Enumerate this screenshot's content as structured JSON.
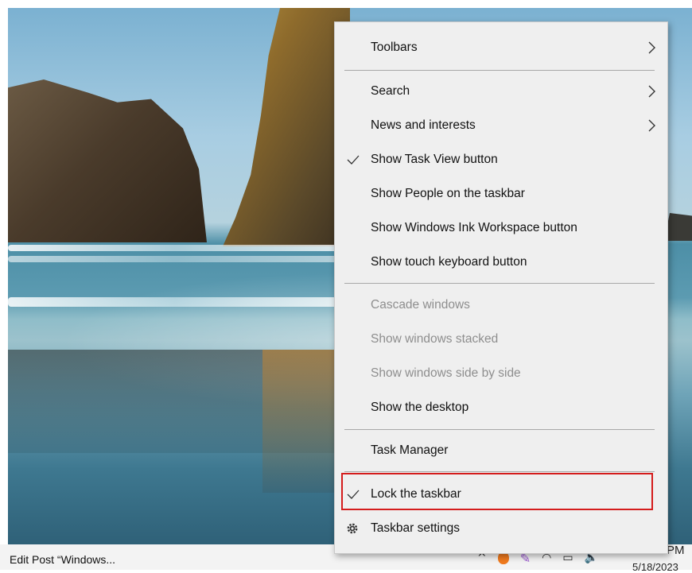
{
  "taskbar": {
    "app_label": "Edit Post “Windows...",
    "clock_time": "PM",
    "clock_date": "5/18/2023"
  },
  "context_menu": {
    "items": [
      {
        "label": "Toolbars",
        "submenu": true,
        "checked": false,
        "disabled": false
      },
      {
        "label": "Search",
        "submenu": true,
        "checked": false,
        "disabled": false
      },
      {
        "label": "News and interests",
        "submenu": true,
        "checked": false,
        "disabled": false
      },
      {
        "label": "Show Task View button",
        "submenu": false,
        "checked": true,
        "disabled": false
      },
      {
        "label": "Show People on the taskbar",
        "submenu": false,
        "checked": false,
        "disabled": false
      },
      {
        "label": "Show Windows Ink Workspace button",
        "submenu": false,
        "checked": false,
        "disabled": false
      },
      {
        "label": "Show touch keyboard button",
        "submenu": false,
        "checked": false,
        "disabled": false
      },
      {
        "label": "Cascade windows",
        "submenu": false,
        "checked": false,
        "disabled": true
      },
      {
        "label": "Show windows stacked",
        "submenu": false,
        "checked": false,
        "disabled": true
      },
      {
        "label": "Show windows side by side",
        "submenu": false,
        "checked": false,
        "disabled": true
      },
      {
        "label": "Show the desktop",
        "submenu": false,
        "checked": false,
        "disabled": false
      },
      {
        "label": "Task Manager",
        "submenu": false,
        "checked": false,
        "disabled": false
      },
      {
        "label": "Lock the taskbar",
        "submenu": false,
        "checked": true,
        "disabled": false,
        "highlighted": true
      },
      {
        "label": "Taskbar settings",
        "submenu": false,
        "checked": false,
        "disabled": false,
        "icon": "gear-icon"
      }
    ]
  },
  "colors": {
    "menu_background": "#efefef",
    "highlight_border": "#d41c1c",
    "disabled_text": "#8e8e8e"
  }
}
